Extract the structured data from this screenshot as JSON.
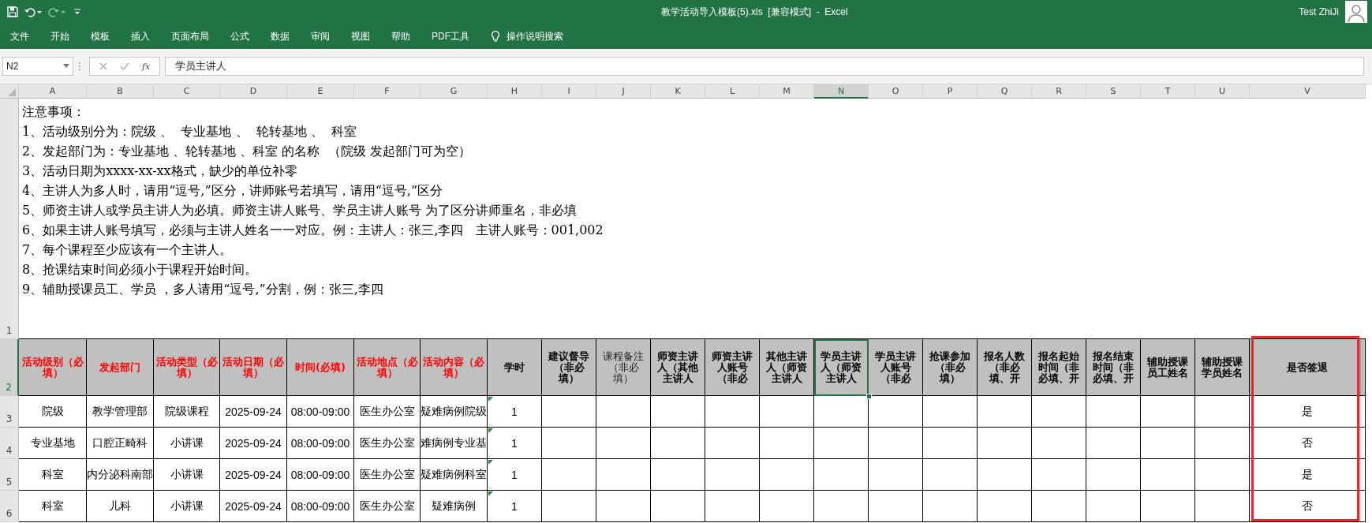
{
  "app": {
    "title": "教学活动导入模板(5).xls  [兼容模式]  -  Excel",
    "user": "Test ZhiJi"
  },
  "ribbon": {
    "tabs": [
      "文件",
      "开始",
      "模板",
      "插入",
      "页面布局",
      "公式",
      "数据",
      "审阅",
      "视图",
      "帮助",
      "PDF工具"
    ],
    "tell_me": "操作说明搜索"
  },
  "formula_bar": {
    "name_box": "N2",
    "fx": "fx",
    "value": "学员主讲人"
  },
  "columns": [
    {
      "label": "A",
      "selected": false,
      "highlighted": false
    },
    {
      "label": "B",
      "selected": false,
      "highlighted": false
    },
    {
      "label": "C",
      "selected": false,
      "highlighted": false
    },
    {
      "label": "D",
      "selected": false,
      "highlighted": false
    },
    {
      "label": "E",
      "selected": false,
      "highlighted": false
    },
    {
      "label": "F",
      "selected": false,
      "highlighted": false
    },
    {
      "label": "G",
      "selected": false,
      "highlighted": false
    },
    {
      "label": "H",
      "selected": false,
      "highlighted": false
    },
    {
      "label": "I",
      "selected": false,
      "highlighted": false
    },
    {
      "label": "J",
      "selected": false,
      "highlighted": false
    },
    {
      "label": "K",
      "selected": false,
      "highlighted": false
    },
    {
      "label": "L",
      "selected": false,
      "highlighted": false
    },
    {
      "label": "M",
      "selected": false,
      "highlighted": false
    },
    {
      "label": "N",
      "selected": true,
      "highlighted": false
    },
    {
      "label": "O",
      "selected": false,
      "highlighted": false
    },
    {
      "label": "P",
      "selected": false,
      "highlighted": false
    },
    {
      "label": "Q",
      "selected": false,
      "highlighted": false
    },
    {
      "label": "R",
      "selected": false,
      "highlighted": false
    },
    {
      "label": "S",
      "selected": false,
      "highlighted": false
    },
    {
      "label": "T",
      "selected": false,
      "highlighted": false
    },
    {
      "label": "U",
      "selected": false,
      "highlighted": false
    },
    {
      "label": "V",
      "selected": false,
      "highlighted": true
    }
  ],
  "rows": [
    {
      "label": "1",
      "selected": false
    },
    {
      "label": "2",
      "selected": true
    },
    {
      "label": "3",
      "selected": false
    },
    {
      "label": "4",
      "selected": false
    },
    {
      "label": "5",
      "selected": false
    },
    {
      "label": "6",
      "selected": false
    }
  ],
  "notes": [
    "注意事项：",
    "1、活动级别分为：院级 、  专业基地 、  轮转基地 、  科室",
    "2、发起部门为：专业基地 、轮转基地 、科室 的名称  （院级 发起部门可为空）",
    "3、活动日期为xxxx-xx-xx格式，缺少的单位补零",
    "4、主讲人为多人时，请用“逗号,”区分，讲师账号若填写，请用“逗号,”区分",
    "5、师资主讲人或学员主讲人为必填。师资主讲人账号、学员主讲人账号 为了区分讲师重名，非必填",
    "6、如果主讲人账号填写，必须与主讲人姓名一一对应。例：主讲人：张三,李四   主讲人账号：001,002",
    "7、每个课程至少应该有一个主讲人。",
    "8、抢课结束时间必须小于课程开始时间。",
    "9、辅助授课员工、学员 ，多人请用“逗号,”分割，例：张三,李四"
  ],
  "header_cells": [
    {
      "text": "活动级别（必填）",
      "kind": "required",
      "selected": false
    },
    {
      "text": "发起部门",
      "kind": "required",
      "selected": false
    },
    {
      "text": "活动类型（必填）",
      "kind": "required",
      "selected": false
    },
    {
      "text": "活动日期（必填）",
      "kind": "required",
      "selected": false
    },
    {
      "text": "时间(必填)",
      "kind": "required",
      "selected": false
    },
    {
      "text": "活动地点（必填）",
      "kind": "required",
      "selected": false
    },
    {
      "text": "活动内容（必填）",
      "kind": "required",
      "selected": false
    },
    {
      "text": "学时",
      "kind": "normal",
      "selected": false
    },
    {
      "text": "建议督导（非必填）",
      "kind": "normal",
      "selected": false
    },
    {
      "text": "课程备注（非必填）",
      "kind": "light",
      "selected": false
    },
    {
      "text": "师资主讲人（其他主讲人",
      "kind": "normal",
      "selected": false
    },
    {
      "text": "师资主讲人账号（非必",
      "kind": "normal",
      "selected": false
    },
    {
      "text": "其他主讲人（师资主讲人",
      "kind": "normal",
      "selected": false
    },
    {
      "text": "学员主讲人（师资主讲人",
      "kind": "normal",
      "selected": true
    },
    {
      "text": "学员主讲人账号（非必",
      "kind": "normal",
      "selected": false
    },
    {
      "text": "抢课参加（非必填）",
      "kind": "normal",
      "selected": false
    },
    {
      "text": "报名人数（非必填、开",
      "kind": "normal",
      "selected": false
    },
    {
      "text": "报名起始时间（非必填、开",
      "kind": "normal",
      "selected": false
    },
    {
      "text": "报名结束时间（非必填、开",
      "kind": "normal",
      "selected": false
    },
    {
      "text": "辅助授课员工姓名",
      "kind": "normal",
      "selected": false
    },
    {
      "text": "辅助授课学员姓名",
      "kind": "normal",
      "selected": false
    },
    {
      "text": "是否签退",
      "kind": "normal",
      "selected": false
    }
  ],
  "data_rows": [
    {
      "cells": {
        "A": "院级",
        "B": "教学管理部",
        "C": "院级课程",
        "D": "2025-09-24",
        "E": "08:00-09:00",
        "F": "医生办公室",
        "G": "疑难病例院级",
        "H": "1",
        "V": "是"
      },
      "flagged": true
    },
    {
      "cells": {
        "A": "专业基地",
        "B": "口腔正畸科",
        "C": "小讲课",
        "D": "2025-09-24",
        "E": "08:00-09:00",
        "F": "医生办公室",
        "G": "难病例专业基",
        "H": "1",
        "V": "否"
      },
      "flagged": true
    },
    {
      "cells": {
        "A": "科室",
        "B": "内分泌科南部",
        "C": "小讲课",
        "D": "2025-09-24",
        "E": "08:00-09:00",
        "F": "医生办公室",
        "G": "疑难病例科室",
        "H": "1",
        "V": "是"
      },
      "flagged": true
    },
    {
      "cells": {
        "A": "科室",
        "B": "儿科",
        "C": "小讲课",
        "D": "2025-09-24",
        "E": "08:00-09:00",
        "F": "医生办公室",
        "G": "疑难病例",
        "H": "1",
        "V": "否"
      },
      "flagged": true
    }
  ]
}
